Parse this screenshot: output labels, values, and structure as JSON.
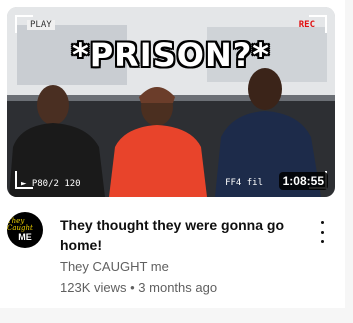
{
  "video": {
    "thumbnail": {
      "headline": "*PRISON?*",
      "rec_label": "REC",
      "hud_top_left": "PLAY",
      "hud_bottom_left": "► P80/2 120",
      "hud_bottom_right": "FF4 fil",
      "duration": "1:08:55"
    },
    "title": "They thought they were gonna go home!",
    "channel_name": "They CAUGHT me",
    "views": "123K views",
    "separator": "•",
    "age": "3 months ago",
    "menu_icon": "more-vert-icon"
  },
  "avatar": {
    "line1": "They Caught",
    "line2": "ME",
    "colors": {
      "background": "#000000",
      "line1": "#f2d500",
      "line2": "#ffffff"
    }
  },
  "colors": {
    "title": "#0f0f0f",
    "meta": "#606060",
    "duration_bg": "#000000",
    "rec": "#e01010"
  }
}
